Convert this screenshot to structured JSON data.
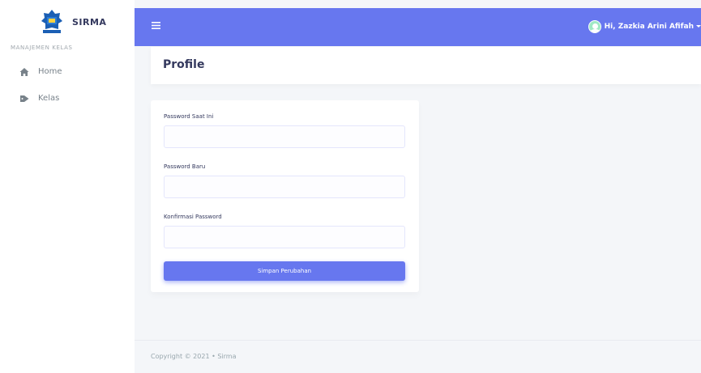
{
  "brand": {
    "name": "SIRMA",
    "logo": "university-logo"
  },
  "sidebar": {
    "section_header": "MANAJEMEN KELAS",
    "items": [
      {
        "label": "Home",
        "icon": "home-icon"
      },
      {
        "label": "Kelas",
        "icon": "tag-icon"
      }
    ]
  },
  "navbar": {
    "menu_icon": "hamburger-menu-icon",
    "user_greeting": "Hi, Zazkia Arini Afifah",
    "accent_color": "#6777ef"
  },
  "page": {
    "title": "Profile"
  },
  "form": {
    "fields": [
      {
        "label": "Password Saat Ini",
        "value": ""
      },
      {
        "label": "Password Baru",
        "value": ""
      },
      {
        "label": "Konfirmasi Password",
        "value": ""
      }
    ],
    "submit_label": "Simpan Perubahan"
  },
  "footer": {
    "copyright": "Copyright © 2021 • Sirma"
  }
}
